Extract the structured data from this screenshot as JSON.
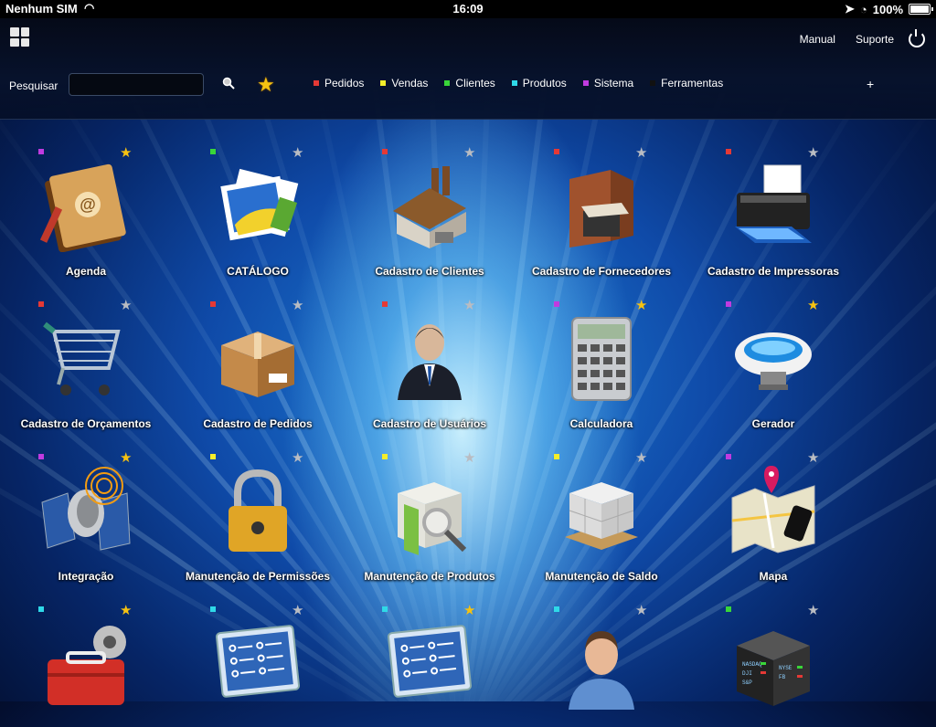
{
  "status": {
    "carrier": "Nenhum SIM",
    "time": "16:09",
    "battery": "100%"
  },
  "header": {
    "manual": "Manual",
    "suporte": "Suporte",
    "search_label": "Pesquisar",
    "search_value": ""
  },
  "categories": [
    {
      "label": "Pedidos",
      "color": "#e53935"
    },
    {
      "label": "Vendas",
      "color": "#f4ee2a"
    },
    {
      "label": "Clientes",
      "color": "#39d539"
    },
    {
      "label": "Produtos",
      "color": "#2fd9e8"
    },
    {
      "label": "Sistema",
      "color": "#c03be0"
    },
    {
      "label": "Ferramentas",
      "color": "#111111"
    }
  ],
  "apps": [
    {
      "label": "Agenda",
      "cat_color": "#c03be0",
      "fav": true,
      "icon": "address-book-icon"
    },
    {
      "label": "CATÁLOGO",
      "cat_color": "#39d539",
      "fav": false,
      "icon": "photos-icon"
    },
    {
      "label": "Cadastro de Clientes",
      "cat_color": "#e53935",
      "fav": false,
      "icon": "factory-icon"
    },
    {
      "label": "Cadastro de Fornecedores",
      "cat_color": "#e53935",
      "fav": false,
      "icon": "warehouse-icon"
    },
    {
      "label": "Cadastro de Impressoras",
      "cat_color": "#e53935",
      "fav": false,
      "icon": "printer-icon"
    },
    {
      "label": "Cadastro de Orçamentos",
      "cat_color": "#e53935",
      "fav": false,
      "icon": "shopping-cart-icon"
    },
    {
      "label": "Cadastro de Pedidos",
      "cat_color": "#e53935",
      "fav": false,
      "icon": "box-icon"
    },
    {
      "label": "Cadastro de Usuários",
      "cat_color": "#e53935",
      "fav": false,
      "icon": "businessman-icon"
    },
    {
      "label": "Calculadora",
      "cat_color": "#c03be0",
      "fav": true,
      "icon": "calculator-icon"
    },
    {
      "label": "Gerador",
      "cat_color": "#c03be0",
      "fav": true,
      "icon": "generator-icon"
    },
    {
      "label": "Integração",
      "cat_color": "#c03be0",
      "fav": true,
      "icon": "satellite-icon"
    },
    {
      "label": "Manutenção de Permissões",
      "cat_color": "#f4ee2a",
      "fav": false,
      "icon": "padlock-icon"
    },
    {
      "label": "Manutenção de Produtos",
      "cat_color": "#f4ee2a",
      "fav": false,
      "icon": "product-search-icon"
    },
    {
      "label": "Manutenção de Saldo",
      "cat_color": "#f4ee2a",
      "fav": false,
      "icon": "pallet-boxes-icon"
    },
    {
      "label": "Mapa",
      "cat_color": "#c03be0",
      "fav": false,
      "icon": "map-icon"
    },
    {
      "label": "",
      "cat_color": "#2fd9e8",
      "fav": true,
      "icon": "toolbox-icon"
    },
    {
      "label": "",
      "cat_color": "#2fd9e8",
      "fav": false,
      "icon": "checklist-icon"
    },
    {
      "label": "",
      "cat_color": "#2fd9e8",
      "fav": true,
      "icon": "checklist-icon"
    },
    {
      "label": "",
      "cat_color": "#2fd9e8",
      "fav": false,
      "icon": "doctor-icon"
    },
    {
      "label": "",
      "cat_color": "#39d539",
      "fav": false,
      "icon": "stock-board-icon"
    }
  ]
}
